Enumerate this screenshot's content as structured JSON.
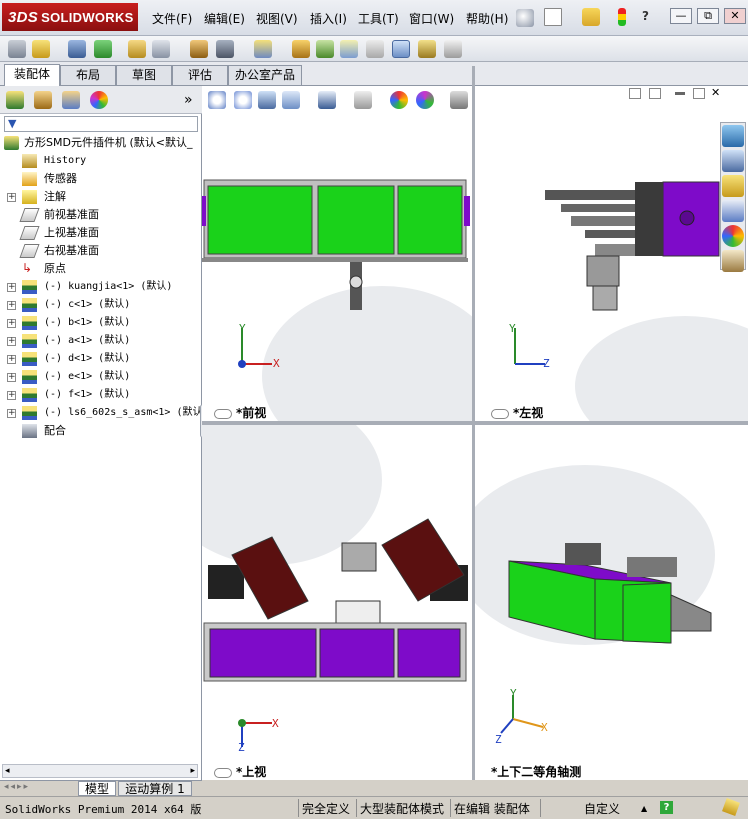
{
  "app": {
    "logo_ds": "3DS",
    "logo_text": "SOLIDWORKS"
  },
  "menu": [
    "文件(F)",
    "编辑(E)",
    "视图(V)",
    "插入(I)",
    "工具(T)",
    "窗口(W)",
    "帮助(H)"
  ],
  "window_controls": {
    "help_text": "?",
    "minimize": "—",
    "restore": "⧉",
    "close": "✕"
  },
  "command_tabs": [
    "装配体",
    "布局",
    "草图",
    "评估",
    "办公室产品"
  ],
  "feature_tree": {
    "root": "方形SMD元件插件机  (默认<默认_",
    "items": [
      {
        "label": "History",
        "icon": "history-icon",
        "expand": false
      },
      {
        "label": "传感器",
        "icon": "sensor-icon",
        "expand": false
      },
      {
        "label": "注解",
        "icon": "annotation-icon",
        "expand": true
      },
      {
        "label": "前视基准面",
        "icon": "plane-icon",
        "expand": false
      },
      {
        "label": "上视基准面",
        "icon": "plane-icon",
        "expand": false
      },
      {
        "label": "右视基准面",
        "icon": "plane-icon",
        "expand": false
      },
      {
        "label": "原点",
        "icon": "origin-icon",
        "expand": false
      },
      {
        "label": "(-) kuangjia<1> (默认)",
        "icon": "part-icon",
        "expand": true
      },
      {
        "label": "(-) c<1> (默认)",
        "icon": "part-icon",
        "expand": true
      },
      {
        "label": "(-) b<1> (默认)",
        "icon": "part-icon",
        "expand": true
      },
      {
        "label": "(-) a<1> (默认)",
        "icon": "part-icon",
        "expand": true
      },
      {
        "label": "(-) d<1> (默认)",
        "icon": "part-icon",
        "expand": true
      },
      {
        "label": "(-) e<1> (默认)",
        "icon": "part-icon",
        "expand": true
      },
      {
        "label": "(-) f<1> (默认)",
        "icon": "part-icon",
        "expand": true
      },
      {
        "label": "(-) ls6_602s_s_asm<1> (默认",
        "icon": "part-icon",
        "expand": true
      },
      {
        "label": "配合",
        "icon": "mates-icon",
        "expand": false
      }
    ]
  },
  "viewports": {
    "front": {
      "label": "*前视",
      "axis_y": "Y",
      "axis_x": "X"
    },
    "left": {
      "label": "*左视",
      "axis_y": "Y",
      "axis_x": "Z"
    },
    "top": {
      "label": "*上视",
      "axis_z": "Z",
      "axis_x": "X"
    },
    "iso": {
      "label": "*上下二等角轴测",
      "axis_y": "Y",
      "axis_x": "X",
      "axis_z": "Z"
    }
  },
  "bottom_tabs": [
    "模型",
    "运动算例 1"
  ],
  "status": {
    "product": "SolidWorks Premium 2014 x64 版",
    "fully_defined": "完全定义",
    "large_mode": "大型装配体模式",
    "editing": "在编辑 装配体",
    "custom": "自定义"
  },
  "colors": {
    "machine_green": "#1ad21a",
    "machine_purple": "#7e0bc9",
    "accent_red": "#c81e1e"
  }
}
